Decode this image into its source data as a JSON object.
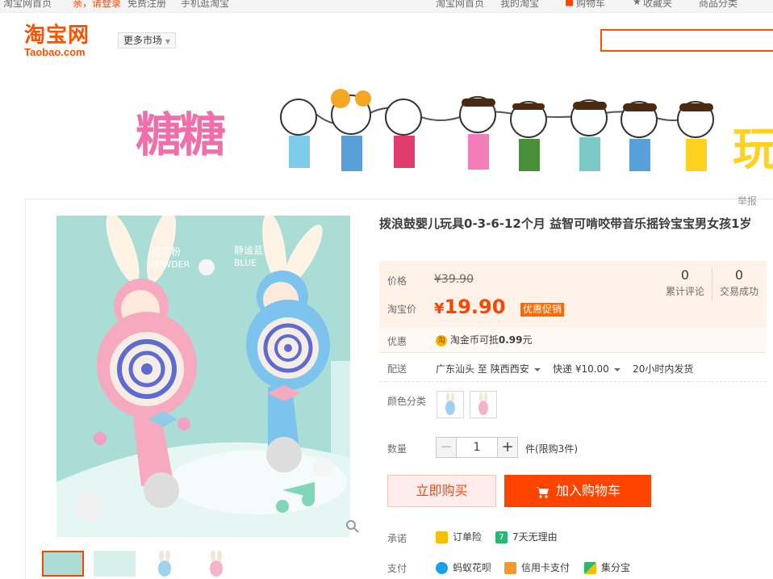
{
  "topbar": {
    "home": "淘宝网首页",
    "login": "亲，请登录",
    "register": "免费注册",
    "mobile": "手机逛淘宝",
    "my_taobao": "我的淘宝",
    "cart": "购物车",
    "favorites": "收藏夹",
    "categories": "商品分类"
  },
  "logo": {
    "cn": "淘宝网",
    "en": "Taobao.com"
  },
  "nav": {
    "more_market": "更多市场"
  },
  "banner": {
    "left_text": "糖糖",
    "right_text": "玩"
  },
  "report": "举报",
  "product": {
    "title": "拨浪鼓婴儿玩具0-3-6-12个月 益智可啃咬带音乐摇铃宝宝男女孩1岁",
    "image_labels": {
      "pink_cn": "樱花粉",
      "pink_en": "POWDER",
      "blue_cn": "静谧蓝",
      "blue_en": "BLUE"
    }
  },
  "price": {
    "label": "价格",
    "original": "¥39.90",
    "tb_label": "淘宝价",
    "currency": "¥",
    "current": "19.90",
    "promo": "优惠促销",
    "reviews_count": "0",
    "reviews_label": "累计评论",
    "sales_count": "0",
    "sales_label": "交易成功"
  },
  "coupon": {
    "label": "优惠",
    "icon_char": "淘",
    "text": "淘金币可抵",
    "amount": "0.99",
    "unit": "元"
  },
  "shipping": {
    "label": "配送",
    "from": "广东汕头",
    "to_word": "至",
    "to": "陕西西安",
    "method": "快递",
    "fee": "¥10.00",
    "dispatch": "20小时内发货"
  },
  "color": {
    "label": "颜色分类"
  },
  "quantity": {
    "label": "数量",
    "minus": "−",
    "value": "1",
    "plus": "+",
    "limit": "件(限购3件)"
  },
  "buttons": {
    "buy_now": "立即购买",
    "add_cart": "加入购物车"
  },
  "promise": {
    "label": "承诺",
    "item1": "订单险",
    "item2": "7天无理由",
    "item2_icon": "7"
  },
  "payment": {
    "label": "支付",
    "item1": "蚂蚁花呗",
    "item2": "信用卡支付",
    "item3": "集分宝"
  },
  "colors": {
    "brand": "#ff5000",
    "price": "#ff4400",
    "pink": "#f7a9c0",
    "blue": "#7cc4ee",
    "mint": "#a9ddd5"
  }
}
